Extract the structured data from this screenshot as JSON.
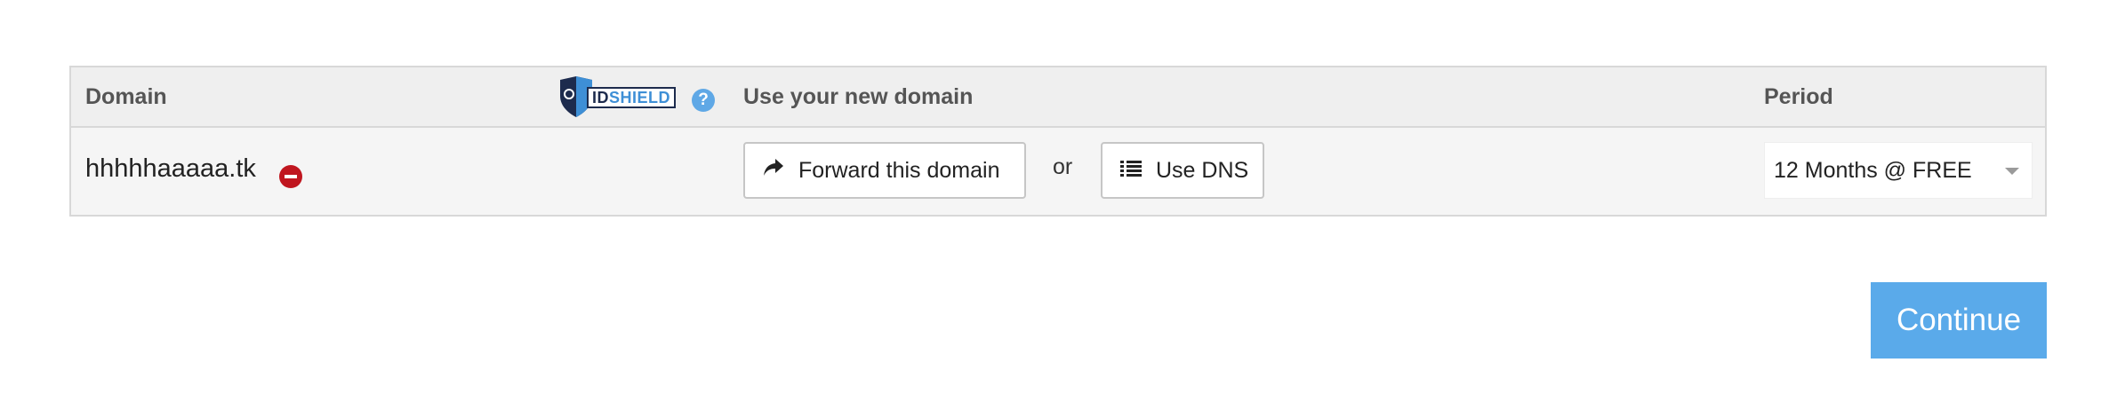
{
  "table": {
    "headers": {
      "domain": "Domain",
      "use_domain": "Use your new domain",
      "period": "Period"
    },
    "idshield": {
      "brand_id": "ID",
      "brand_shield": "SHIELD",
      "help_icon": "question-circle-icon",
      "help_glyph": "?"
    },
    "row": {
      "domain_name": "hhhhhaaaaa.tk",
      "remove_icon": "minus-circle-icon",
      "forward_button": "Forward this domain",
      "forward_icon": "share-arrow-icon",
      "or_text": "or",
      "dns_button": "Use DNS",
      "dns_icon": "list-icon",
      "period_selected": "12 Months @ FREE"
    }
  },
  "continue_button": "Continue",
  "colors": {
    "accent": "#5aaaea",
    "remove": "#c0161f",
    "header_bg": "#efefef",
    "row_bg": "#f5f5f5"
  }
}
